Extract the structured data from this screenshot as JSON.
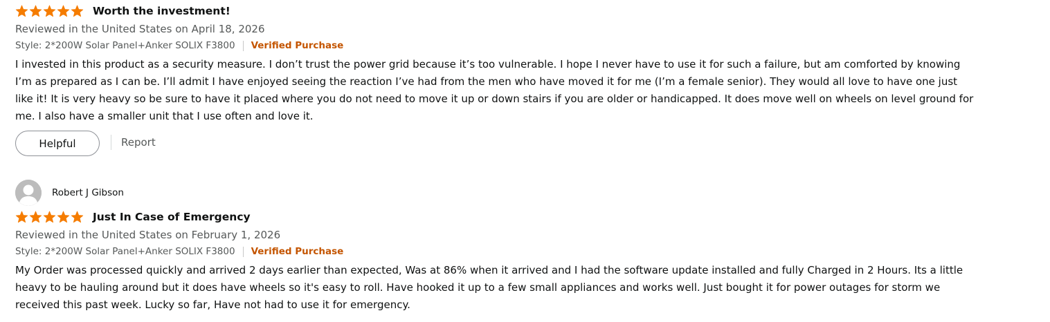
{
  "colors": {
    "star": "#f57c00",
    "verified": "#c45500",
    "muted_text": "#565959",
    "body_text": "#0f1111"
  },
  "star_icon": "star-icon",
  "reviews": [
    {
      "rating": 5,
      "title": "Worth the investment!",
      "date": "Reviewed in the United States on April 18, 2026",
      "style": "Style: 2*200W Solar Panel+Anker SOLIX F3800",
      "verified": "Verified Purchase",
      "body": "I invested in this product as a security measure. I don’t trust the power grid because it’s too vulnerable. I hope I never have to use it for such a failure, but am comforted by knowing I’m as prepared as I can be. I’ll admit I have enjoyed seeing the reaction I’ve had from the men who have moved it for me (I’m a female senior). They would all love to have one just like it! It is very heavy so be sure to have it placed where you do not need to move it up or down stairs if you are older or handicapped. It does move well on wheels on level ground for me. I also have a smaller unit that I use often and love it.",
      "helpful_label": "Helpful",
      "report_label": "Report"
    },
    {
      "author": "Robert J Gibson",
      "rating": 5,
      "title": "Just In Case of Emergency",
      "date": "Reviewed in the United States on February 1, 2026",
      "style": "Style: 2*200W Solar Panel+Anker SOLIX F3800",
      "verified": "Verified Purchase",
      "body": "My Order was processed quickly and arrived 2 days earlier than expected, Was at 86% when it arrived and I had the software update installed and fully Charged in 2 Hours. Its a little heavy to be hauling around but it does have wheels so it's easy to roll. Have hooked it up to a few small appliances and works well. Just bought it for power outages for storm we received this past week. Lucky so far, Have not had to use it for emergency."
    }
  ]
}
